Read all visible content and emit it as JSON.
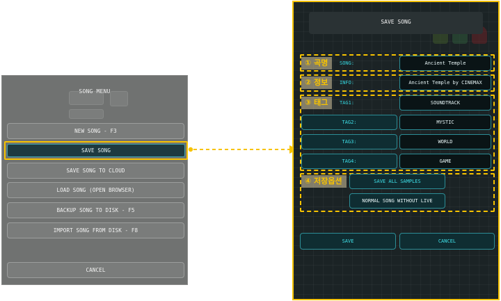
{
  "song_menu": {
    "title": "SONG MENU",
    "items": [
      {
        "label": "NEW SONG - F3"
      },
      {
        "label": "SAVE SONG"
      },
      {
        "label": "SAVE SONG TO CLOUD"
      },
      {
        "label": "LOAD SONG (OPEN BROWSER)"
      },
      {
        "label": "BACKUP SONG TO DISK  - F5"
      },
      {
        "label": "IMPORT SONG FROM DISK - F8"
      }
    ],
    "cancel_label": "CANCEL"
  },
  "save_song": {
    "title": "SAVE SONG",
    "annotations": {
      "song_name": "① 곡명",
      "info": "② 정보",
      "tags": "③ 태그",
      "save_options": "④ 저장옵션"
    },
    "fields": {
      "song": {
        "label": "SONG:",
        "value": "Ancient Temple"
      },
      "info": {
        "label": "INFO:",
        "value": "Ancient Temple by CINEMAX"
      },
      "tag1": {
        "label": "TAG1:",
        "value": "SOUNDTRACK"
      },
      "tag2": {
        "label": "TAG2:",
        "value": "MYSTIC"
      },
      "tag3": {
        "label": "TAG3:",
        "value": "WORLD"
      },
      "tag4": {
        "label": "TAG4:",
        "value": "GAME"
      }
    },
    "options": {
      "save_all_samples": "SAVE ALL SAMPLES",
      "normal_song": "NORMAL SONG WITHOUT LIVE"
    },
    "save_label": "SAVE",
    "cancel_label": "CANCEL"
  },
  "colors": {
    "highlight": "#f7c300",
    "accent_cyan": "#35d7e0",
    "panel_dark": "#1b2325"
  }
}
